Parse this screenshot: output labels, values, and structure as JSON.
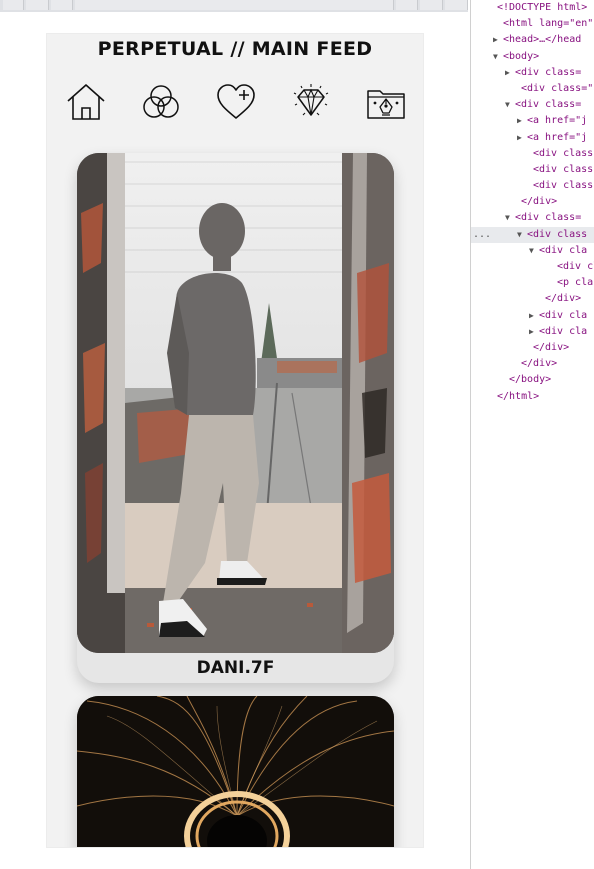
{
  "page": {
    "title": "PERPETUAL // MAIN FEED"
  },
  "nav": [
    {
      "icon": "home-icon"
    },
    {
      "icon": "venn-circles-icon"
    },
    {
      "icon": "heart-plus-icon"
    },
    {
      "icon": "diamond-icon"
    },
    {
      "icon": "folder-pen-icon"
    }
  ],
  "feed": [
    {
      "username": "DANI.7F"
    }
  ],
  "devtools": {
    "lines": [
      {
        "indent": 20,
        "toggle": "",
        "text": "<!DOCTYPE html>"
      },
      {
        "indent": 26,
        "toggle": "",
        "text": "<html lang=\"en\""
      },
      {
        "indent": 26,
        "toggle": "▶",
        "text": "<head>…</head"
      },
      {
        "indent": 26,
        "toggle": "▼",
        "text": "<body>"
      },
      {
        "indent": 38,
        "toggle": "▶",
        "text": "<div class="
      },
      {
        "indent": 44,
        "toggle": "",
        "text": "<div class=\""
      },
      {
        "indent": 38,
        "toggle": "▼",
        "text": "<div class="
      },
      {
        "indent": 50,
        "toggle": "▶",
        "text": "<a href=\"j"
      },
      {
        "indent": 50,
        "toggle": "▶",
        "text": "<a href=\"j"
      },
      {
        "indent": 56,
        "toggle": "",
        "text": "<div class"
      },
      {
        "indent": 56,
        "toggle": "",
        "text": "<div class"
      },
      {
        "indent": 56,
        "toggle": "",
        "text": "<div class"
      },
      {
        "indent": 44,
        "toggle": "",
        "text": "</div>"
      },
      {
        "indent": 38,
        "toggle": "▼",
        "text": "<div class="
      },
      {
        "indent": 50,
        "toggle": "▼",
        "text": "<div class",
        "selected": true
      },
      {
        "indent": 62,
        "toggle": "▼",
        "text": "<div cla"
      },
      {
        "indent": 80,
        "toggle": "",
        "text": "<div cl"
      },
      {
        "indent": 80,
        "toggle": "",
        "text": "<p clas"
      },
      {
        "indent": 68,
        "toggle": "",
        "text": "</div>"
      },
      {
        "indent": 62,
        "toggle": "▶",
        "text": "<div cla"
      },
      {
        "indent": 62,
        "toggle": "▶",
        "text": "<div cla"
      },
      {
        "indent": 56,
        "toggle": "",
        "text": "</div>"
      },
      {
        "indent": 44,
        "toggle": "",
        "text": "</div>"
      },
      {
        "indent": 32,
        "toggle": "",
        "text": "</body>"
      },
      {
        "indent": 20,
        "toggle": "",
        "text": "</html>"
      }
    ],
    "selected_marker": "..."
  }
}
